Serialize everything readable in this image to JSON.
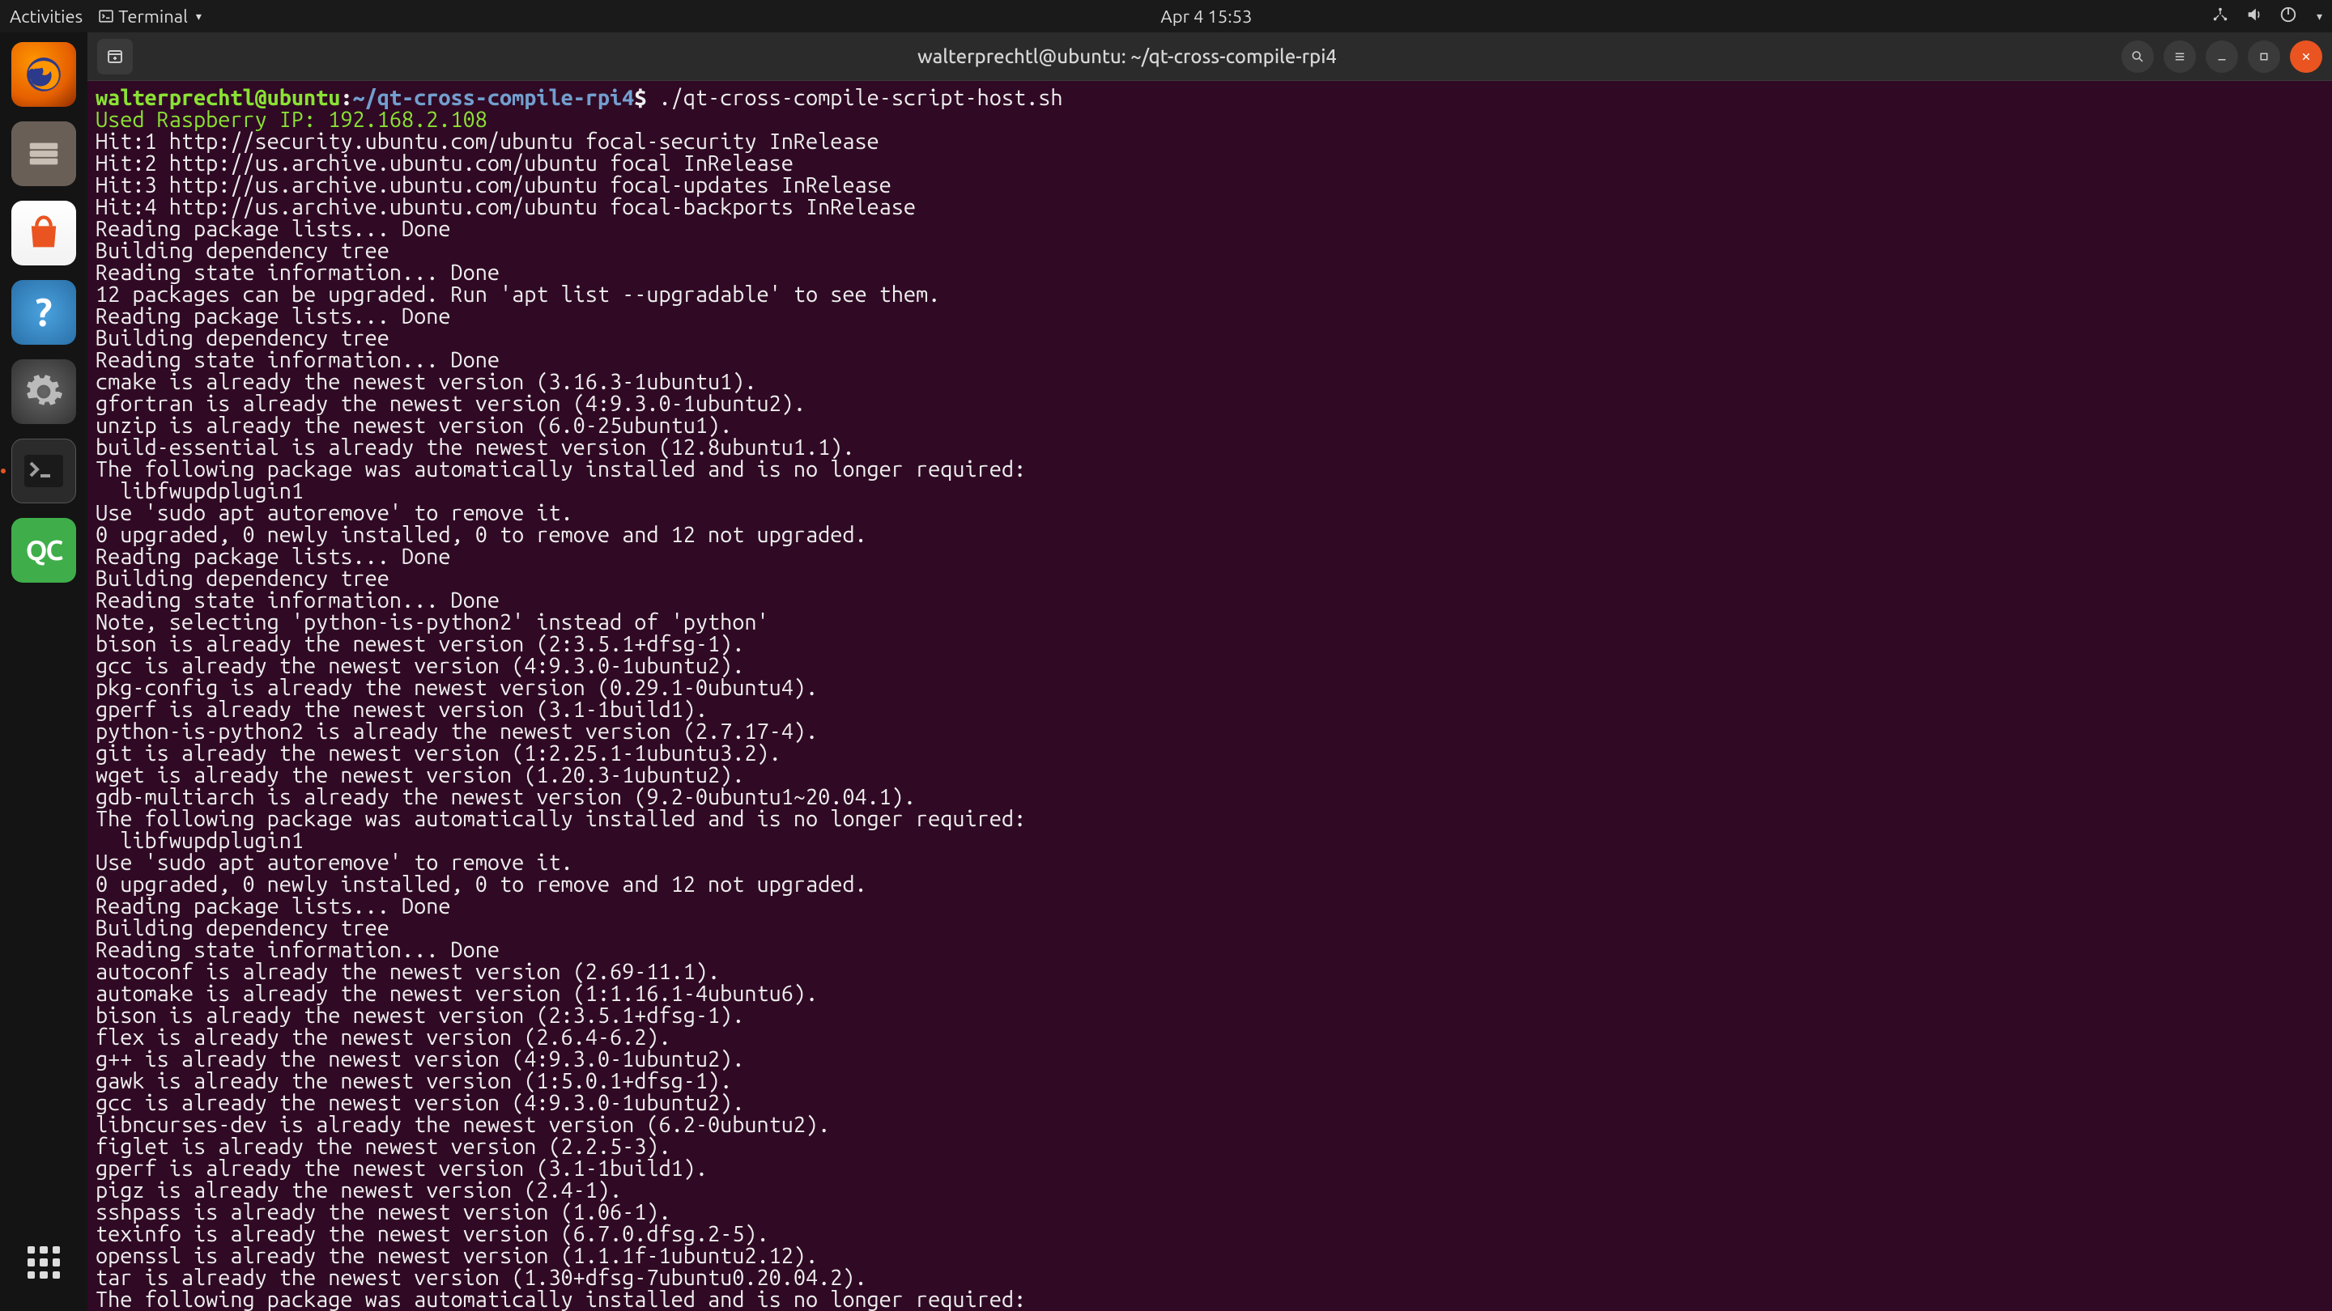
{
  "panel": {
    "activities": "Activities",
    "appmenu_label": "Terminal",
    "clock": "Apr 4  15:53"
  },
  "window": {
    "title": "walterprechtl@ubuntu: ~/qt-cross-compile-rpi4"
  },
  "prompt": {
    "user_host": "walterprechtl@ubuntu",
    "sep1": ":",
    "path": "~/qt-cross-compile-rpi4",
    "sep2": "$ ",
    "command": "./qt-cross-compile-script-host.sh"
  },
  "info_line": "Used Raspberry IP: 192.168.2.108",
  "output_lines": [
    "Hit:1 http://security.ubuntu.com/ubuntu focal-security InRelease",
    "Hit:2 http://us.archive.ubuntu.com/ubuntu focal InRelease",
    "Hit:3 http://us.archive.ubuntu.com/ubuntu focal-updates InRelease",
    "Hit:4 http://us.archive.ubuntu.com/ubuntu focal-backports InRelease",
    "Reading package lists... Done",
    "Building dependency tree",
    "Reading state information... Done",
    "12 packages can be upgraded. Run 'apt list --upgradable' to see them.",
    "Reading package lists... Done",
    "Building dependency tree",
    "Reading state information... Done",
    "cmake is already the newest version (3.16.3-1ubuntu1).",
    "gfortran is already the newest version (4:9.3.0-1ubuntu2).",
    "unzip is already the newest version (6.0-25ubuntu1).",
    "build-essential is already the newest version (12.8ubuntu1.1).",
    "The following package was automatically installed and is no longer required:",
    "  libfwupdplugin1",
    "Use 'sudo apt autoremove' to remove it.",
    "0 upgraded, 0 newly installed, 0 to remove and 12 not upgraded.",
    "Reading package lists... Done",
    "Building dependency tree",
    "Reading state information... Done",
    "Note, selecting 'python-is-python2' instead of 'python'",
    "bison is already the newest version (2:3.5.1+dfsg-1).",
    "gcc is already the newest version (4:9.3.0-1ubuntu2).",
    "pkg-config is already the newest version (0.29.1-0ubuntu4).",
    "gperf is already the newest version (3.1-1build1).",
    "python-is-python2 is already the newest version (2.7.17-4).",
    "git is already the newest version (1:2.25.1-1ubuntu3.2).",
    "wget is already the newest version (1.20.3-1ubuntu2).",
    "gdb-multiarch is already the newest version (9.2-0ubuntu1~20.04.1).",
    "The following package was automatically installed and is no longer required:",
    "  libfwupdplugin1",
    "Use 'sudo apt autoremove' to remove it.",
    "0 upgraded, 0 newly installed, 0 to remove and 12 not upgraded.",
    "Reading package lists... Done",
    "Building dependency tree",
    "Reading state information... Done",
    "autoconf is already the newest version (2.69-11.1).",
    "automake is already the newest version (1:1.16.1-4ubuntu6).",
    "bison is already the newest version (2:3.5.1+dfsg-1).",
    "flex is already the newest version (2.6.4-6.2).",
    "g++ is already the newest version (4:9.3.0-1ubuntu2).",
    "gawk is already the newest version (1:5.0.1+dfsg-1).",
    "gcc is already the newest version (4:9.3.0-1ubuntu2).",
    "libncurses-dev is already the newest version (6.2-0ubuntu2).",
    "figlet is already the newest version (2.2.5-3).",
    "gperf is already the newest version (3.1-1build1).",
    "pigz is already the newest version (2.4-1).",
    "sshpass is already the newest version (1.06-1).",
    "texinfo is already the newest version (6.7.0.dfsg.2-5).",
    "openssl is already the newest version (1.1.1f-1ubuntu2.12).",
    "tar is already the newest version (1.30+dfsg-7ubuntu0.20.04.2).",
    "The following package was automatically installed and is no longer required:"
  ]
}
